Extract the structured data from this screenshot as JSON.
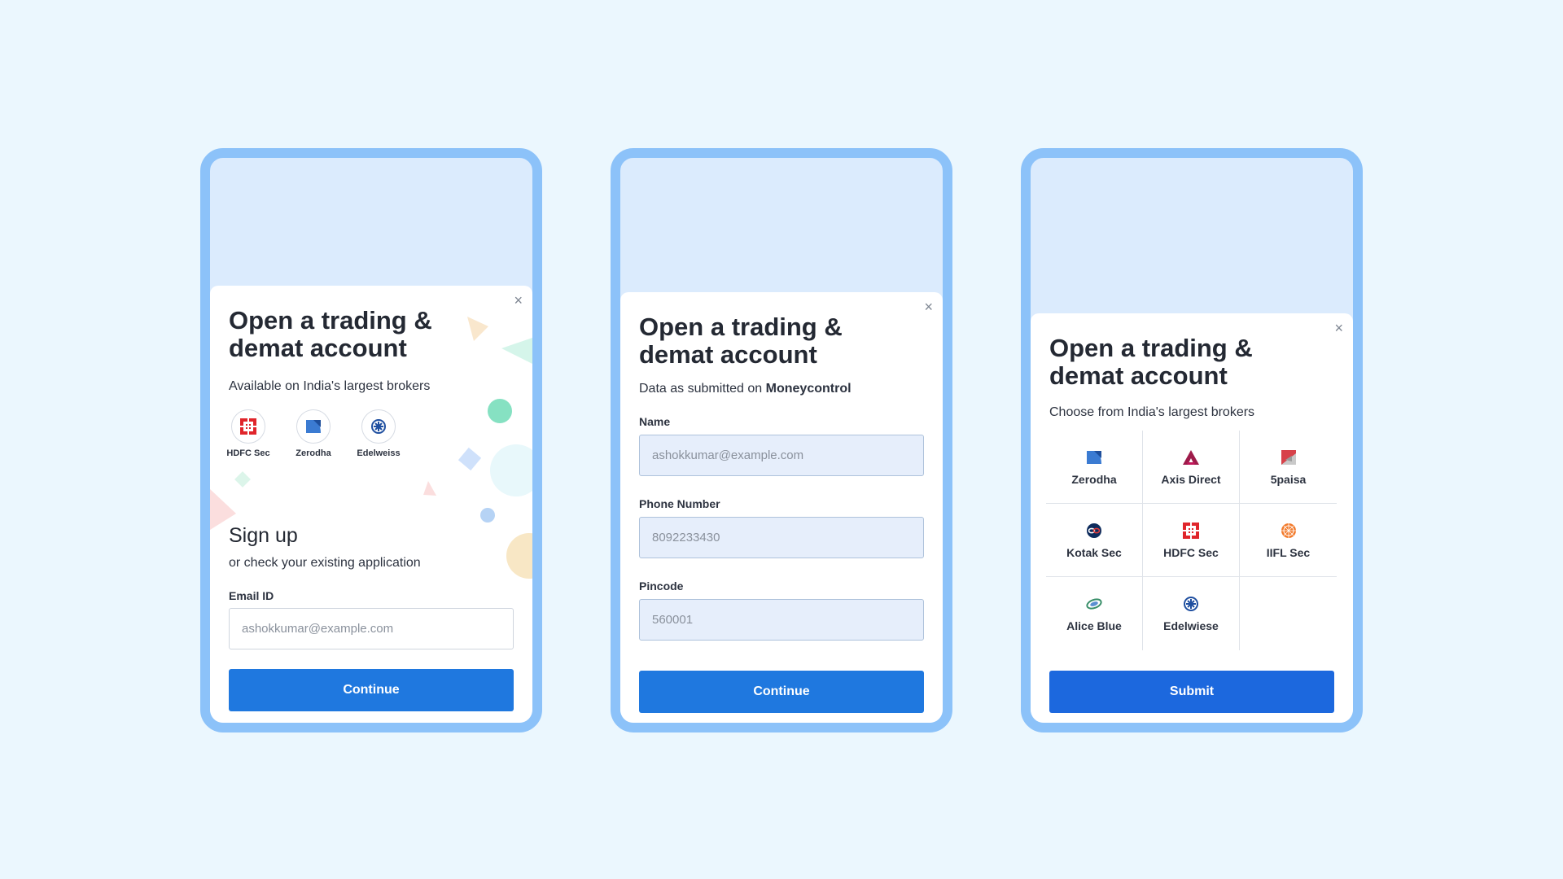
{
  "screens": [
    {
      "title": "Open a trading &\ndemat account",
      "subtitle": "Available on India's largest brokers",
      "brokers": [
        {
          "name": "HDFC Sec",
          "icon": "hdfc-icon"
        },
        {
          "name": "Zerodha",
          "icon": "zerodha-icon"
        },
        {
          "name": "Edelweiss",
          "icon": "edelweiss-icon"
        }
      ],
      "signup_title": "Sign up",
      "signup_subtitle": "or check your existing application",
      "email_label": "Email ID",
      "email_placeholder": "ashokkumar@example.com",
      "button_label": "Continue",
      "close_glyph": "×"
    },
    {
      "title": "Open a trading &\ndemat account",
      "subtitle_prefix": "Data as submitted on ",
      "subtitle_brand": "Moneycontrol",
      "name_label": "Name",
      "name_value": "ashokkumar@example.com",
      "phone_label": "Phone Number",
      "phone_value": "8092233430",
      "pincode_label": "Pincode",
      "pincode_value": "560001",
      "button_label": "Continue",
      "close_glyph": "×"
    },
    {
      "title": "Open a trading &\ndemat account",
      "subtitle": "Choose from India's largest brokers",
      "brokers": [
        {
          "name": "Zerodha",
          "icon": "zerodha-icon"
        },
        {
          "name": "Axis Direct",
          "icon": "axis-icon"
        },
        {
          "name": "5paisa",
          "icon": "5paisa-icon"
        },
        {
          "name": "Kotak Sec",
          "icon": "kotak-icon"
        },
        {
          "name": "HDFC Sec",
          "icon": "hdfc-icon"
        },
        {
          "name": "IIFL Sec",
          "icon": "iifl-icon"
        },
        {
          "name": "Alice Blue",
          "icon": "aliceblue-icon"
        },
        {
          "name": "Edelwiese",
          "icon": "edelweiss-icon"
        }
      ],
      "button_label": "Submit",
      "close_glyph": "×"
    }
  ],
  "colors": {
    "background": "#ebf7fe",
    "phone_frame": "#8cc2f9",
    "primary_button": "#1f78df",
    "submit_button": "#1c68de"
  }
}
